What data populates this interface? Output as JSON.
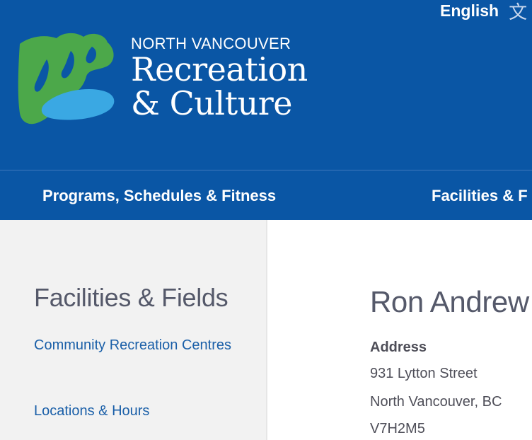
{
  "header": {
    "language_label": "English",
    "language_icon": "translate-icon",
    "logo": {
      "kicker": "NORTH VANCOUVER",
      "line1": "Recreation",
      "line2": "& Culture",
      "colors": {
        "green": "#4ca84a",
        "blue": "#3aa8e3",
        "background": "#0a56a5"
      }
    }
  },
  "nav": {
    "items": [
      {
        "label": "Programs, Schedules & Fitness"
      },
      {
        "label": "Facilities & F"
      }
    ]
  },
  "sidebar": {
    "title": "Facilities & Fields",
    "links": [
      {
        "label": "Community Recreation Centres"
      },
      {
        "label": "Locations & Hours"
      }
    ]
  },
  "main": {
    "title": "Ron Andrew",
    "address_label": "Address",
    "address_lines": [
      "931 Lytton Street",
      "North Vancouver, BC",
      "V7H2M5"
    ]
  }
}
